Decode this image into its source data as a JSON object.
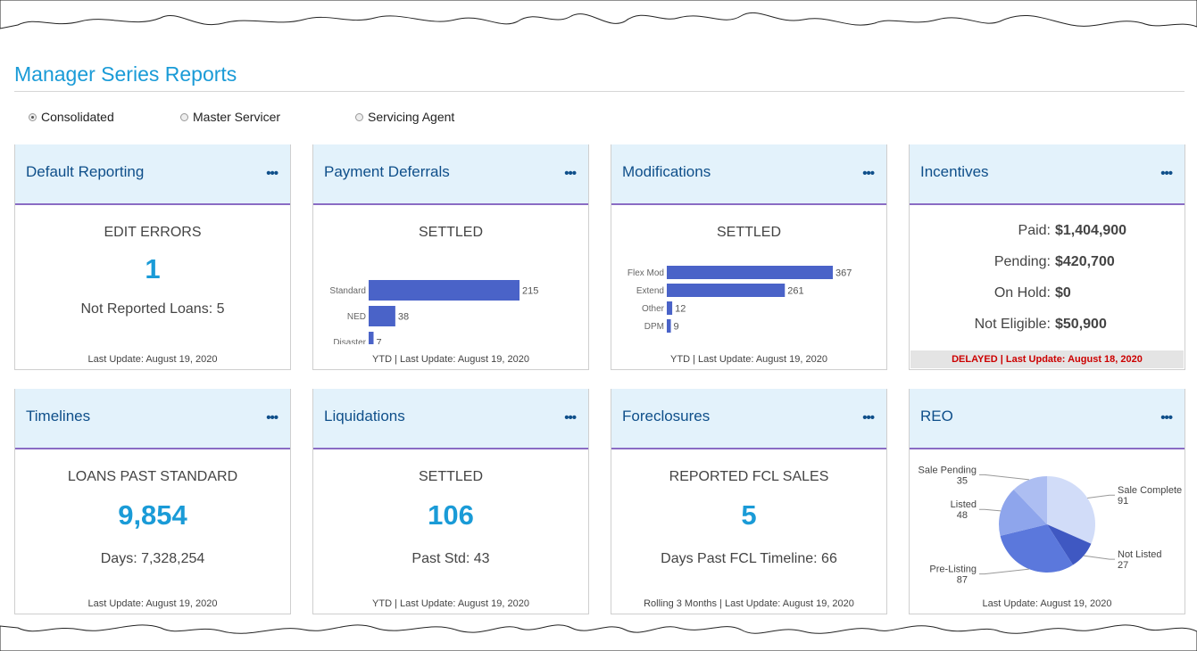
{
  "page": {
    "title": "Manager Series Reports"
  },
  "view_options": [
    {
      "label": "Consolidated",
      "selected": true
    },
    {
      "label": "Master Servicer",
      "selected": false
    },
    {
      "label": "Servicing Agent",
      "selected": false
    }
  ],
  "colors": {
    "accent": "#1a9bd7",
    "header_bg": "#e3f2fb",
    "divider": "#8a6cc4",
    "bar": "#4a63c8",
    "delayed": "#cc0000"
  },
  "cards": {
    "default_reporting": {
      "title": "Default Reporting",
      "menu": "•••",
      "label": "EDIT ERRORS",
      "value": "1",
      "detail": "Not Reported Loans: 5",
      "footer": "Last Update: August 19, 2020"
    },
    "payment_deferrals": {
      "title": "Payment Deferrals",
      "menu": "•••",
      "label": "SETTLED",
      "footer": "YTD | Last Update: August 19, 2020"
    },
    "modifications": {
      "title": "Modifications",
      "menu": "•••",
      "label": "SETTLED",
      "footer": "YTD | Last Update: August 19, 2020"
    },
    "incentives": {
      "title": "Incentives",
      "menu": "•••",
      "rows": [
        {
          "label": "Paid:",
          "value": "$1,404,900"
        },
        {
          "label": "Pending:",
          "value": "$420,700"
        },
        {
          "label": "On Hold:",
          "value": "$0"
        },
        {
          "label": "Not Eligible:",
          "value": "$50,900"
        }
      ],
      "footer": "DELAYED | Last Update: August 18, 2020"
    },
    "timelines": {
      "title": "Timelines",
      "menu": "•••",
      "label": "LOANS PAST STANDARD",
      "value": "9,854",
      "detail": "Days: 7,328,254",
      "footer": "Last Update: August 19, 2020"
    },
    "liquidations": {
      "title": "Liquidations",
      "menu": "•••",
      "label": "SETTLED",
      "value": "106",
      "detail": "Past Std: 43",
      "footer": "YTD | Last Update: August 19, 2020"
    },
    "foreclosures": {
      "title": "Foreclosures",
      "menu": "•••",
      "label": "REPORTED FCL SALES",
      "value": "5",
      "detail": "Days Past FCL Timeline: 66",
      "footer": "Rolling 3 Months | Last Update: August 19, 2020"
    },
    "reo": {
      "title": "REO",
      "menu": "•••",
      "footer": "Last Update: August 19, 2020"
    }
  },
  "chart_data": [
    {
      "type": "bar",
      "orientation": "horizontal",
      "card": "Payment Deferrals",
      "categories": [
        "Standard",
        "NED",
        "Disaster"
      ],
      "values": [
        215,
        38,
        7
      ]
    },
    {
      "type": "bar",
      "orientation": "horizontal",
      "card": "Modifications",
      "categories": [
        "Flex Mod",
        "Extend",
        "Other",
        "DPM"
      ],
      "values": [
        367,
        261,
        12,
        9
      ]
    },
    {
      "type": "pie",
      "card": "REO",
      "categories": [
        "Sale Complete",
        "Not Listed",
        "Pre-Listing",
        "Listed",
        "Sale Pending"
      ],
      "values": [
        91,
        27,
        87,
        48,
        35
      ],
      "colors": [
        "#d1dcf8",
        "#3f58c2",
        "#5b78dc",
        "#8ea5ec",
        "#adbef2"
      ]
    }
  ]
}
